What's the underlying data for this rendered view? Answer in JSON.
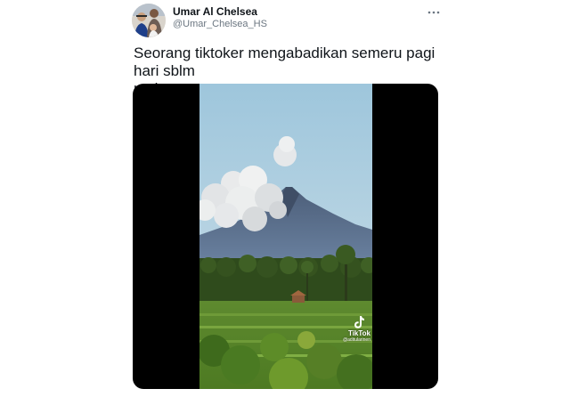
{
  "author": {
    "name": "Umar Al Chelsea",
    "handle": "@Umar_Chelsea_HS"
  },
  "tweet": {
    "text": "Seorang tiktoker mengabadikan semeru pagi hari sblm\nmeletus."
  },
  "more_icon": "more-horizontal-icon",
  "media": {
    "type": "video",
    "watermark": {
      "brand": "TikTok",
      "user": "@aditularinen"
    }
  },
  "colors": {
    "text_primary": "#0f1419",
    "text_secondary": "#6b7681",
    "media_bg": "#000000"
  }
}
